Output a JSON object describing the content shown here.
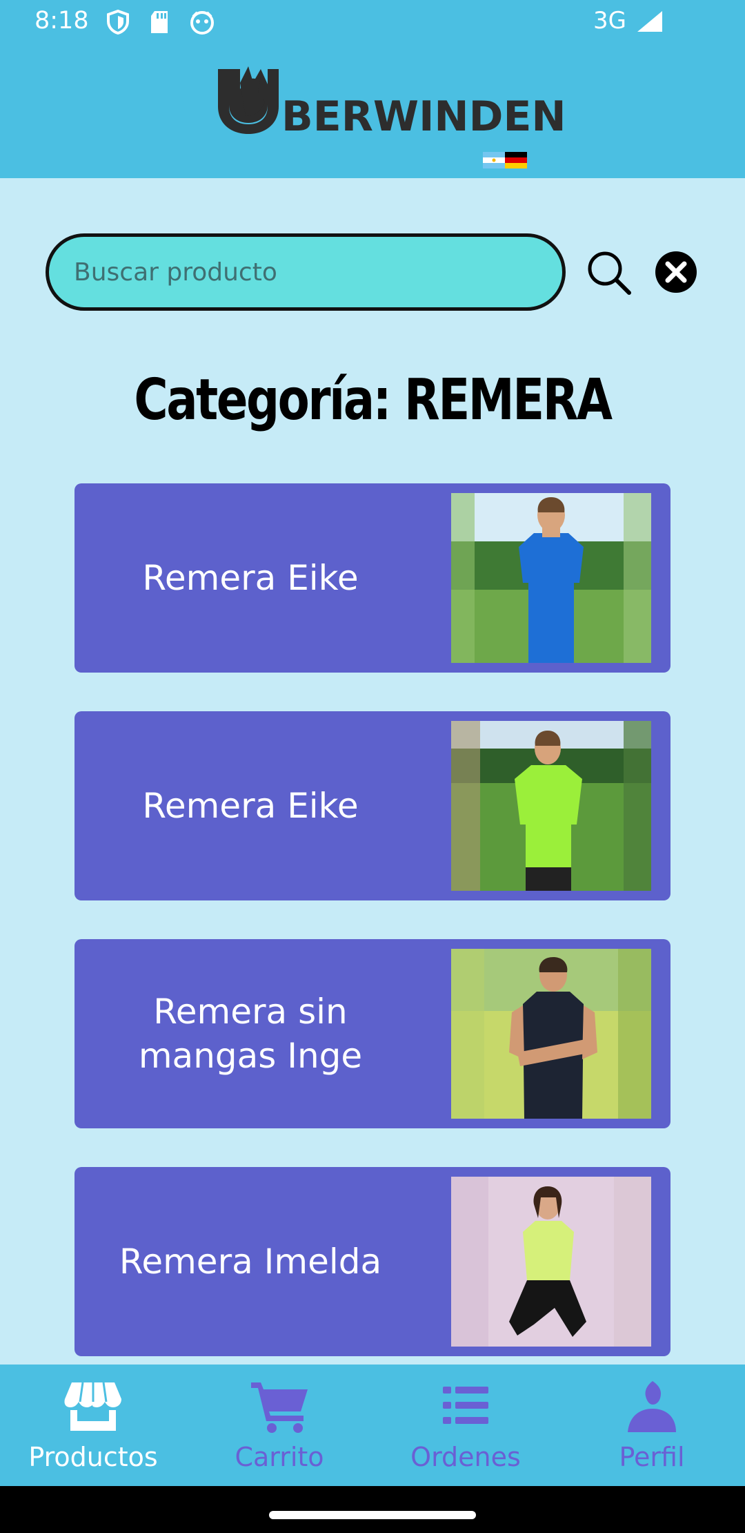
{
  "status_bar": {
    "time": "8:18",
    "network": "3G",
    "icons": [
      "shield-icon",
      "sd-card-icon",
      "emoji-icon",
      "signal-icon"
    ]
  },
  "header": {
    "logo_text": "BERWINDEN",
    "logo_icon": "wolf-cup-icon"
  },
  "search": {
    "placeholder": "Buscar producto",
    "value": "",
    "search_icon": "search-icon",
    "clear_icon": "close-circle-icon"
  },
  "page_title": "Categoría: REMERA",
  "products": [
    {
      "name": "Remera Eike",
      "photo": "man-blue-shirt"
    },
    {
      "name": "Remera Eike",
      "photo": "man-lime-shirt"
    },
    {
      "name": "Remera sin mangas Inge",
      "photo": "man-navy-tank"
    },
    {
      "name": "Remera Imelda",
      "photo": "woman-lime-shirt"
    }
  ],
  "bottom_nav": {
    "items": [
      {
        "label": "Productos",
        "icon": "store-icon",
        "active": true
      },
      {
        "label": "Carrito",
        "icon": "cart-icon",
        "active": false
      },
      {
        "label": "Ordenes",
        "icon": "list-icon",
        "active": false
      },
      {
        "label": "Perfil",
        "icon": "person-icon",
        "active": false
      }
    ]
  },
  "colors": {
    "header": "#4bbfe2",
    "background": "#c6ebf7",
    "card": "#5d61cc",
    "search_field": "#64dfdf",
    "nav_active": "#ffffff",
    "nav_inactive": "#6a60d4"
  }
}
